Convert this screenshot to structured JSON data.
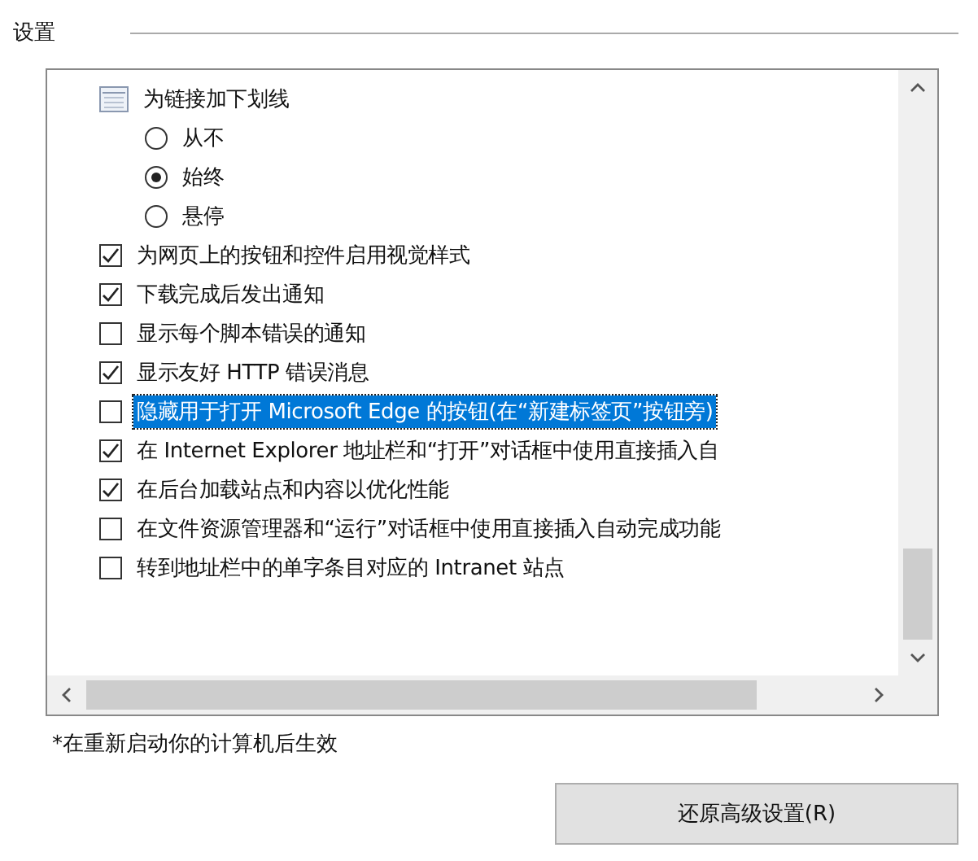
{
  "section_title": "设置",
  "items": [
    {
      "kind": "group",
      "label": "为链接加下划线"
    },
    {
      "kind": "radio",
      "label": "从不",
      "selected": false
    },
    {
      "kind": "radio",
      "label": "始终",
      "selected": true
    },
    {
      "kind": "radio",
      "label": "悬停",
      "selected": false
    },
    {
      "kind": "checkbox",
      "label": "为网页上的按钮和控件启用视觉样式",
      "checked": true,
      "highlighted": false
    },
    {
      "kind": "checkbox",
      "label": "下载完成后发出通知",
      "checked": true,
      "highlighted": false
    },
    {
      "kind": "checkbox",
      "label": "显示每个脚本错误的通知",
      "checked": false,
      "highlighted": false
    },
    {
      "kind": "checkbox",
      "label": "显示友好 HTTP 错误消息",
      "checked": true,
      "highlighted": false
    },
    {
      "kind": "checkbox",
      "label": "隐藏用于打开 Microsoft Edge 的按钮(在“新建标签页”按钮旁)",
      "checked": false,
      "highlighted": true
    },
    {
      "kind": "checkbox",
      "label": "在 Internet Explorer 地址栏和“打开”对话框中使用直接插入自",
      "checked": true,
      "highlighted": false
    },
    {
      "kind": "checkbox",
      "label": "在后台加载站点和内容以优化性能",
      "checked": true,
      "highlighted": false
    },
    {
      "kind": "checkbox",
      "label": "在文件资源管理器和“运行”对话框中使用直接插入自动完成功能",
      "checked": false,
      "highlighted": false
    },
    {
      "kind": "checkbox",
      "label": "转到地址栏中的单字条目对应的 Intranet 站点",
      "checked": false,
      "highlighted": false
    }
  ],
  "note": "*在重新启动你的计算机后生效",
  "reset_button": "还原高级设置(R)"
}
